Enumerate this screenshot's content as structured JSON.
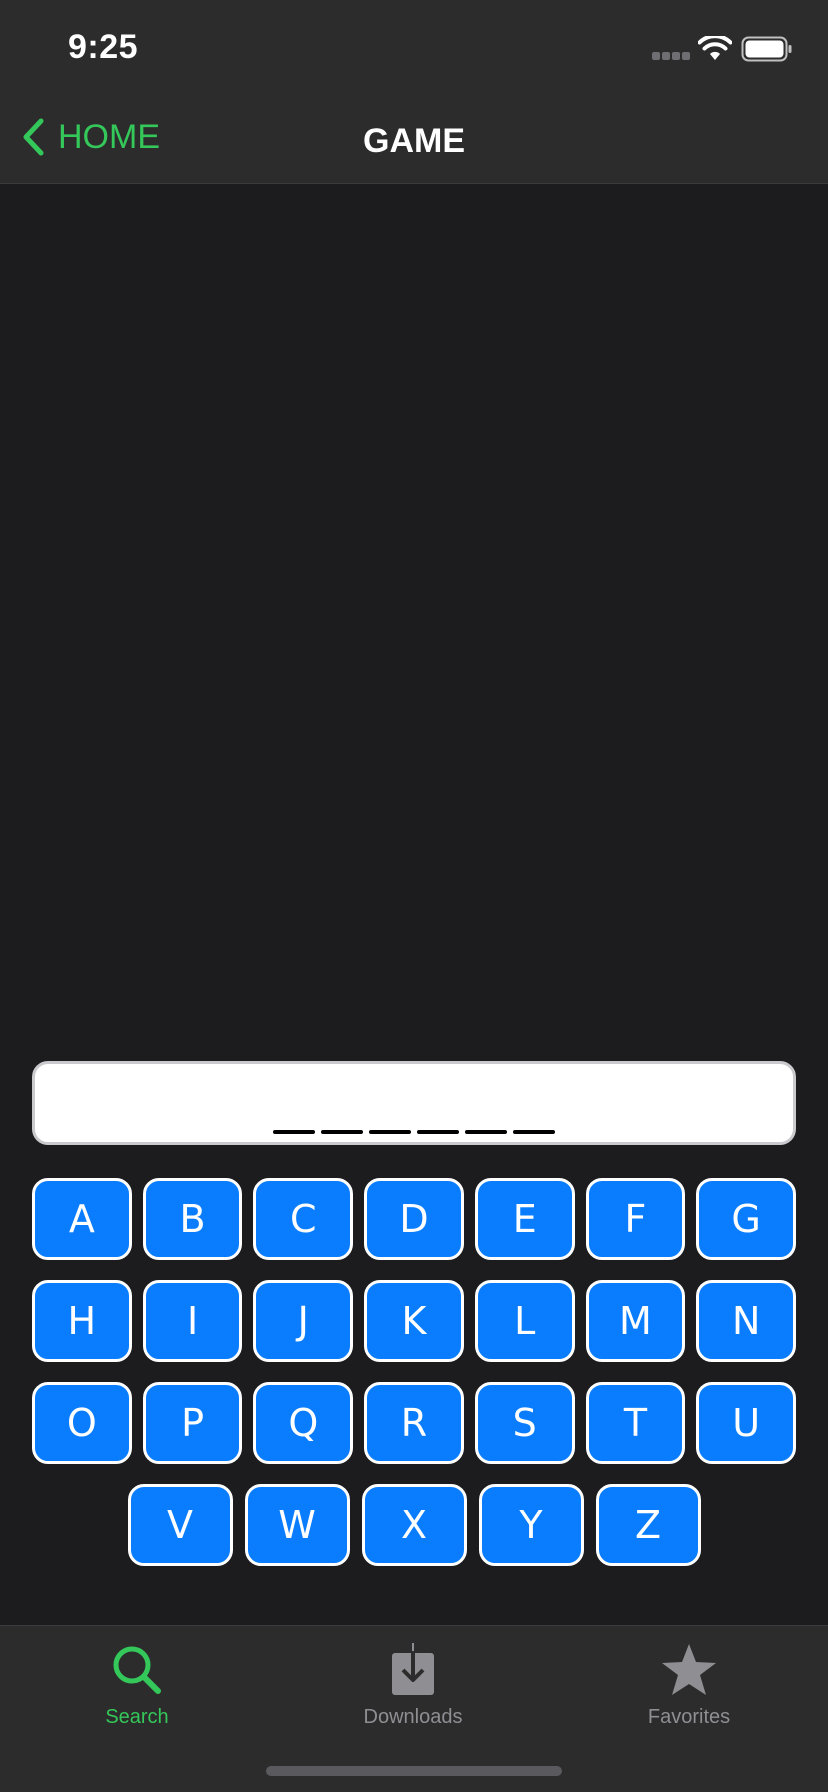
{
  "status_bar": {
    "time": "9:25"
  },
  "nav": {
    "back_label": "HOME",
    "title": "GAME"
  },
  "word": {
    "blank_count": 6
  },
  "keyboard": {
    "rows": [
      [
        "A",
        "B",
        "C",
        "D",
        "E",
        "F",
        "G"
      ],
      [
        "H",
        "I",
        "J",
        "K",
        "L",
        "M",
        "N"
      ],
      [
        "O",
        "P",
        "Q",
        "R",
        "S",
        "T",
        "U"
      ],
      [
        "V",
        "W",
        "X",
        "Y",
        "Z"
      ]
    ]
  },
  "tabs": [
    {
      "label": "Search",
      "icon": "search-icon",
      "active": true
    },
    {
      "label": "Downloads",
      "icon": "download-icon",
      "active": false
    },
    {
      "label": "Favorites",
      "icon": "star-icon",
      "active": false
    }
  ],
  "colors": {
    "accent": "#34c759",
    "key_fill": "#0a7dff",
    "background": "#1c1c1e",
    "bar": "#2c2c2d"
  }
}
